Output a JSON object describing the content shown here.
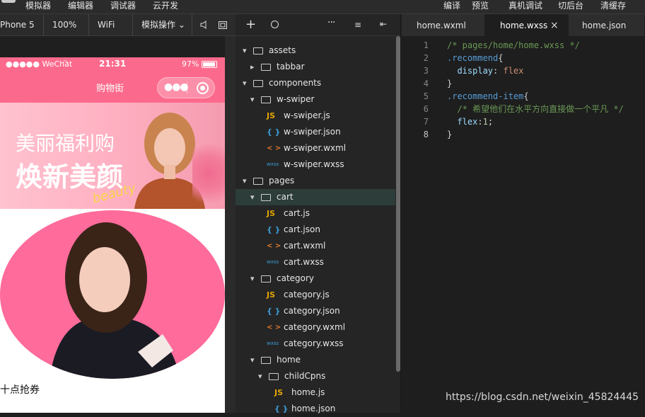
{
  "top_menu": [
    "模拟器",
    "编辑器",
    "调试器",
    "云开发"
  ],
  "top_actions": [
    "编译",
    "预览",
    "真机调试",
    "切后台",
    "清缓存"
  ],
  "toolbar": {
    "device": "Phone 5",
    "zoom": "100%",
    "network": "WiFi",
    "sim_ops": "模拟操作"
  },
  "simulator": {
    "carrier": "●●●●● WeChat",
    "time": "21:31",
    "battery": "97%",
    "nav_title": "购物街",
    "banner_line1": "美丽福利购",
    "banner_line2": "焕新美颜",
    "banner_script": "beauty",
    "coupon_text": "十点抢券"
  },
  "file_tree": [
    {
      "label": "assets",
      "type": "folder",
      "expanded": true
    },
    {
      "label": "tabbar",
      "type": "folder",
      "expanded": false
    },
    {
      "label": "components",
      "type": "folder",
      "expanded": true
    },
    {
      "label": "w-swiper",
      "type": "folder",
      "expanded": true
    },
    {
      "label": "w-swiper.js",
      "type": "js",
      "icon_text": "JS"
    },
    {
      "label": "w-swiper.json",
      "type": "json",
      "icon_text": "{ }"
    },
    {
      "label": "w-swiper.wxml",
      "type": "wxml",
      "icon_text": "< >"
    },
    {
      "label": "w-swiper.wxss",
      "type": "wxss",
      "icon_text": "wxss"
    },
    {
      "label": "pages",
      "type": "folder",
      "expanded": true
    },
    {
      "label": "cart",
      "type": "folder",
      "expanded": true
    },
    {
      "label": "cart.js",
      "type": "js",
      "icon_text": "JS"
    },
    {
      "label": "cart.json",
      "type": "json",
      "icon_text": "{ }"
    },
    {
      "label": "cart.wxml",
      "type": "wxml",
      "icon_text": "< >"
    },
    {
      "label": "cart.wxss",
      "type": "wxss",
      "icon_text": "wxss"
    },
    {
      "label": "category",
      "type": "folder",
      "expanded": true
    },
    {
      "label": "category.js",
      "type": "js",
      "icon_text": "JS"
    },
    {
      "label": "category.json",
      "type": "json",
      "icon_text": "{ }"
    },
    {
      "label": "category.wxml",
      "type": "wxml",
      "icon_text": "< >"
    },
    {
      "label": "category.wxss",
      "type": "wxss",
      "icon_text": "wxss"
    },
    {
      "label": "home",
      "type": "folder",
      "expanded": true
    },
    {
      "label": "childCpns",
      "type": "folder",
      "expanded": true
    },
    {
      "label": "home.js",
      "type": "js",
      "icon_text": "JS"
    },
    {
      "label": "home.json",
      "type": "json",
      "icon_text": "{ }"
    }
  ],
  "selected_node": "cart",
  "editor_tabs": [
    {
      "label": "home.wxml",
      "active": false
    },
    {
      "label": "home.wxss",
      "active": true,
      "close": "×"
    },
    {
      "label": "home.json",
      "active": false
    }
  ],
  "code_lines": [
    [
      {
        "t": "/* pages/home/home.wxss */",
        "c": "comment"
      }
    ],
    [
      {
        "t": ".recommend",
        "c": "sel"
      },
      {
        "t": "{",
        "c": "plain"
      }
    ],
    [
      {
        "t": "  display",
        "c": "prop"
      },
      {
        "t": ": ",
        "c": "plain"
      },
      {
        "t": "flex",
        "c": "val"
      }
    ],
    [
      {
        "t": "}",
        "c": "plain"
      }
    ],
    [
      {
        "t": ".recommend-item",
        "c": "sel"
      },
      {
        "t": "{",
        "c": "plain"
      }
    ],
    [
      {
        "t": "  /* 希望他们在水平方向直接做一个平凡 */",
        "c": "comment"
      }
    ],
    [
      {
        "t": "  flex",
        "c": "prop"
      },
      {
        "t": ":",
        "c": "plain"
      },
      {
        "t": "1",
        "c": "num"
      },
      {
        "t": ";",
        "c": "plain"
      }
    ],
    [
      {
        "t": "}",
        "c": "plain"
      }
    ]
  ],
  "current_line": 8,
  "watermark": "https://blog.csdn.net/weixin_45824445",
  "colors": {
    "accent_pink": "#fb6a8c",
    "selected_row": "#2c3d3a",
    "editor_bg": "#1e1e1e"
  }
}
